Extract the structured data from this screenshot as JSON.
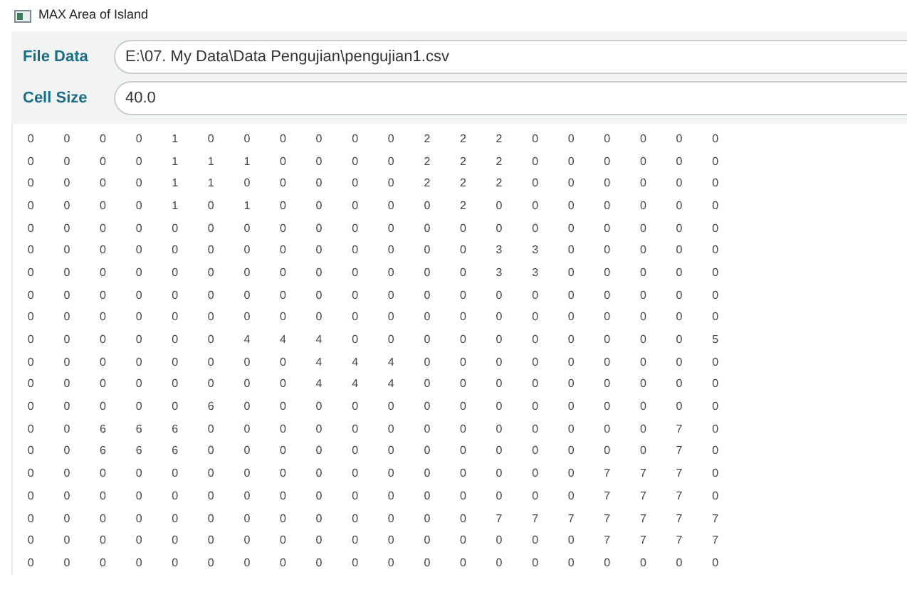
{
  "window": {
    "title": "MAX Area of Island"
  },
  "fields": [
    {
      "label": "File Data",
      "value": "E:\\07. My Data\\Data Pengujian\\pengujian1.csv"
    },
    {
      "label": "Cell Size",
      "value": "40.0"
    }
  ],
  "grid": {
    "rows": [
      [
        "0",
        "0",
        "0",
        "0",
        "1",
        "0",
        "0",
        "0",
        "0",
        "0",
        "0",
        "2",
        "2",
        "2",
        "0",
        "0",
        "0",
        "0",
        "0",
        "0"
      ],
      [
        "0",
        "0",
        "0",
        "0",
        "1",
        "1",
        "1",
        "0",
        "0",
        "0",
        "0",
        "2",
        "2",
        "2",
        "0",
        "0",
        "0",
        "0",
        "0",
        "0"
      ],
      [
        "0",
        "0",
        "0",
        "0",
        "1",
        "1",
        "0",
        "0",
        "0",
        "0",
        "0",
        "2",
        "2",
        "2",
        "0",
        "0",
        "0",
        "0",
        "0",
        "0"
      ],
      [
        "0",
        "0",
        "0",
        "0",
        "1",
        "0",
        "1",
        "0",
        "0",
        "0",
        "0",
        "0",
        "2",
        "0",
        "0",
        "0",
        "0",
        "0",
        "0",
        "0"
      ],
      [
        "0",
        "0",
        "0",
        "0",
        "0",
        "0",
        "0",
        "0",
        "0",
        "0",
        "0",
        "0",
        "0",
        "0",
        "0",
        "0",
        "0",
        "0",
        "0",
        "0"
      ],
      [
        "0",
        "0",
        "0",
        "0",
        "0",
        "0",
        "0",
        "0",
        "0",
        "0",
        "0",
        "0",
        "0",
        "3",
        "3",
        "0",
        "0",
        "0",
        "0",
        "0"
      ],
      [
        "0",
        "0",
        "0",
        "0",
        "0",
        "0",
        "0",
        "0",
        "0",
        "0",
        "0",
        "0",
        "0",
        "3",
        "3",
        "0",
        "0",
        "0",
        "0",
        "0"
      ],
      [
        "0",
        "0",
        "0",
        "0",
        "0",
        "0",
        "0",
        "0",
        "0",
        "0",
        "0",
        "0",
        "0",
        "0",
        "0",
        "0",
        "0",
        "0",
        "0",
        "0"
      ],
      [
        "0",
        "0",
        "0",
        "0",
        "0",
        "0",
        "0",
        "0",
        "0",
        "0",
        "0",
        "0",
        "0",
        "0",
        "0",
        "0",
        "0",
        "0",
        "0",
        "0"
      ],
      [
        "0",
        "0",
        "0",
        "0",
        "0",
        "0",
        "4",
        "4",
        "4",
        "0",
        "0",
        "0",
        "0",
        "0",
        "0",
        "0",
        "0",
        "0",
        "0",
        "5"
      ],
      [
        "0",
        "0",
        "0",
        "0",
        "0",
        "0",
        "0",
        "0",
        "4",
        "4",
        "4",
        "0",
        "0",
        "0",
        "0",
        "0",
        "0",
        "0",
        "0",
        "0"
      ],
      [
        "0",
        "0",
        "0",
        "0",
        "0",
        "0",
        "0",
        "0",
        "4",
        "4",
        "4",
        "0",
        "0",
        "0",
        "0",
        "0",
        "0",
        "0",
        "0",
        "0"
      ],
      [
        "0",
        "0",
        "0",
        "0",
        "0",
        "6",
        "0",
        "0",
        "0",
        "0",
        "0",
        "0",
        "0",
        "0",
        "0",
        "0",
        "0",
        "0",
        "0",
        "0"
      ],
      [
        "0",
        "0",
        "6",
        "6",
        "6",
        "0",
        "0",
        "0",
        "0",
        "0",
        "0",
        "0",
        "0",
        "0",
        "0",
        "0",
        "0",
        "0",
        "7",
        "0"
      ],
      [
        "0",
        "0",
        "6",
        "6",
        "6",
        "0",
        "0",
        "0",
        "0",
        "0",
        "0",
        "0",
        "0",
        "0",
        "0",
        "0",
        "0",
        "0",
        "7",
        "0"
      ],
      [
        "0",
        "0",
        "0",
        "0",
        "0",
        "0",
        "0",
        "0",
        "0",
        "0",
        "0",
        "0",
        "0",
        "0",
        "0",
        "0",
        "7",
        "7",
        "7",
        "0"
      ],
      [
        "0",
        "0",
        "0",
        "0",
        "0",
        "0",
        "0",
        "0",
        "0",
        "0",
        "0",
        "0",
        "0",
        "0",
        "0",
        "0",
        "7",
        "7",
        "7",
        "0"
      ],
      [
        "0",
        "0",
        "0",
        "0",
        "0",
        "0",
        "0",
        "0",
        "0",
        "0",
        "0",
        "0",
        "0",
        "7",
        "7",
        "7",
        "7",
        "7",
        "7",
        "7"
      ],
      [
        "0",
        "0",
        "0",
        "0",
        "0",
        "0",
        "0",
        "0",
        "0",
        "0",
        "0",
        "0",
        "0",
        "0",
        "0",
        "0",
        "7",
        "7",
        "7",
        "7"
      ],
      [
        "0",
        "0",
        "0",
        "0",
        "0",
        "0",
        "0",
        "0",
        "0",
        "0",
        "0",
        "0",
        "0",
        "0",
        "0",
        "0",
        "0",
        "0",
        "0",
        "0"
      ]
    ]
  }
}
